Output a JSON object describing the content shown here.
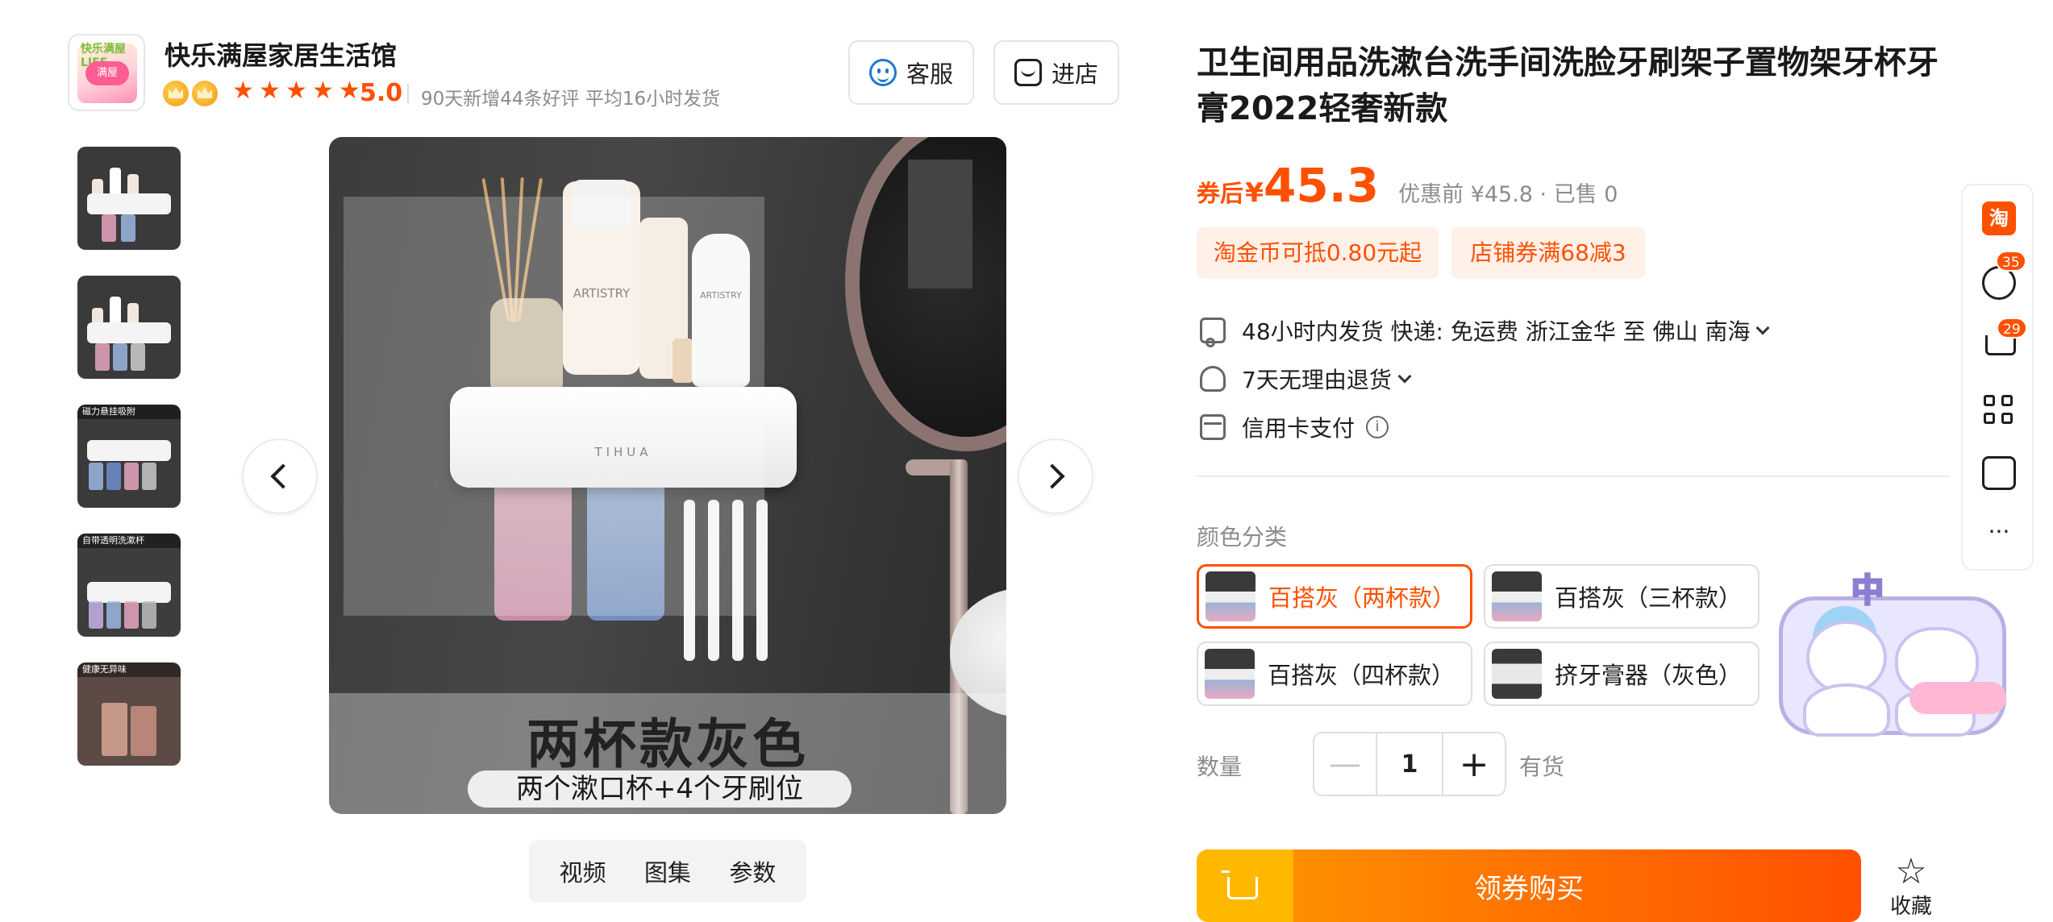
{
  "shop": {
    "logo_text_top": "快乐满屋LIFE",
    "logo_text_mid": "满屋",
    "name": "快乐满屋家居生活馆",
    "rating": "5.0",
    "meta": "90天新增44条好评   平均16小时发货",
    "btn_service": "客服",
    "btn_enter": "进店"
  },
  "gallery": {
    "thumb_captions": [
      "",
      "",
      "磁力悬挂吸附",
      "自带透明洗漱杯",
      "健康无异味"
    ],
    "main_overlay_title": "两杯款灰色",
    "main_overlay_sub": "两个漱口杯+4个牙刷位",
    "bottle_label_1": "ARTISTRY",
    "bottle_label_2": "ARTISTRY",
    "holder_brand": "TIHUA",
    "tabs": [
      "视频",
      "图集",
      "参数"
    ]
  },
  "product": {
    "title": "卫生间用品洗漱台洗手间洗脸牙刷架子置物架牙杯牙膏2022轻奢新款",
    "price_label": "券后",
    "price_currency": "¥",
    "price_value": "45.3",
    "price_orig": "优惠前 ¥45.8 · 已售 0",
    "coupons": [
      "淘金币可抵0.80元起",
      "店铺券满68减3"
    ],
    "services": {
      "shipping": "48小时内发货  快递: 免运费  浙江金华 至 佛山 南海",
      "returns": "7天无理由退货",
      "payment": "信用卡支付"
    },
    "color_label": "颜色分类",
    "skus": [
      "百搭灰（两杯款）",
      "百搭灰（三杯款）",
      "百搭灰（四杯款）",
      "挤牙膏器（灰色）"
    ],
    "selected_sku": 0,
    "qty_label": "数量",
    "qty_minus": "—",
    "qty_value": "1",
    "qty_plus": "+",
    "stock": "有货",
    "buy_label": "领券购买",
    "fav_label": "收藏"
  },
  "rail": {
    "tao_label": "淘",
    "msg_badge": "35",
    "cart_badge": "29",
    "more": "···"
  },
  "mascot": {
    "text": "中"
  },
  "colors": {
    "accent": "#ff5000",
    "coupon_bg": "#fff0e8",
    "cs_blue": "#1f78d1"
  }
}
